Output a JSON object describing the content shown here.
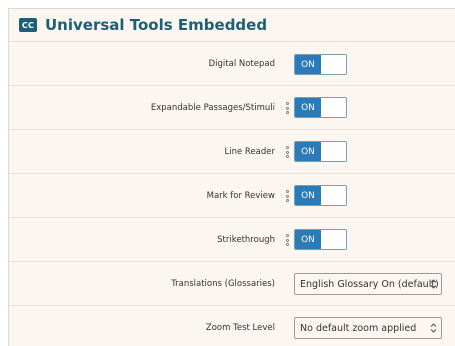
{
  "header": {
    "badge": "CC",
    "title": "Universal Tools Embedded"
  },
  "toggle_state_label": "ON",
  "rows": [
    {
      "label": "Digital Notepad",
      "kind": "toggle",
      "value": "ON",
      "has_tts_icon": false
    },
    {
      "label": "Expandable Passages/Stimuli",
      "kind": "toggle",
      "value": "ON",
      "has_tts_icon": true
    },
    {
      "label": "Line Reader",
      "kind": "toggle",
      "value": "ON",
      "has_tts_icon": true
    },
    {
      "label": "Mark for Review",
      "kind": "toggle",
      "value": "ON",
      "has_tts_icon": true
    },
    {
      "label": "Strikethrough",
      "kind": "toggle",
      "value": "ON",
      "has_tts_icon": true
    },
    {
      "label": "Translations (Glossaries)",
      "kind": "select",
      "value": "English Glossary On (default)"
    },
    {
      "label": "Zoom Test Level",
      "kind": "select",
      "value": "No default zoom applied"
    }
  ],
  "colors": {
    "accent": "#1c5f77",
    "toggle_on": "#2a7bb7",
    "panel_bg": "#fbf6f0"
  }
}
